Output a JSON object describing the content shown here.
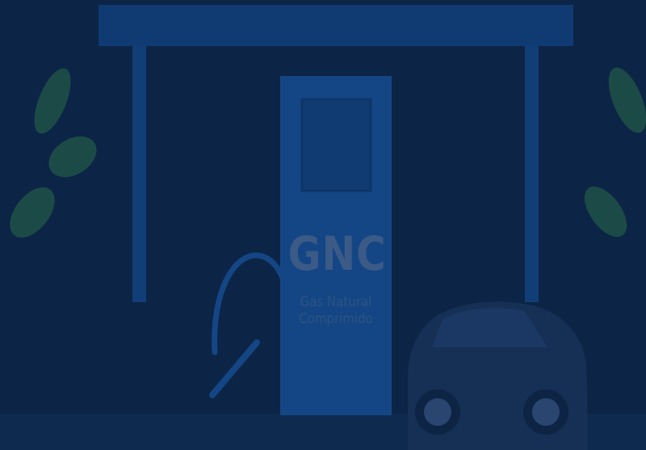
{
  "station": {
    "label": "GNC",
    "sublabel_line1": "Gas Natural",
    "sublabel_line2": "Comprimido"
  },
  "colors": {
    "background": "#0c2446",
    "canopy": "#103a72",
    "pump_body": "#144685",
    "pump_screen": "#103a72",
    "text": "#3b5a86",
    "leaf": "#1c4b47",
    "car": "#162f55",
    "ground": "#0f2a4f"
  }
}
